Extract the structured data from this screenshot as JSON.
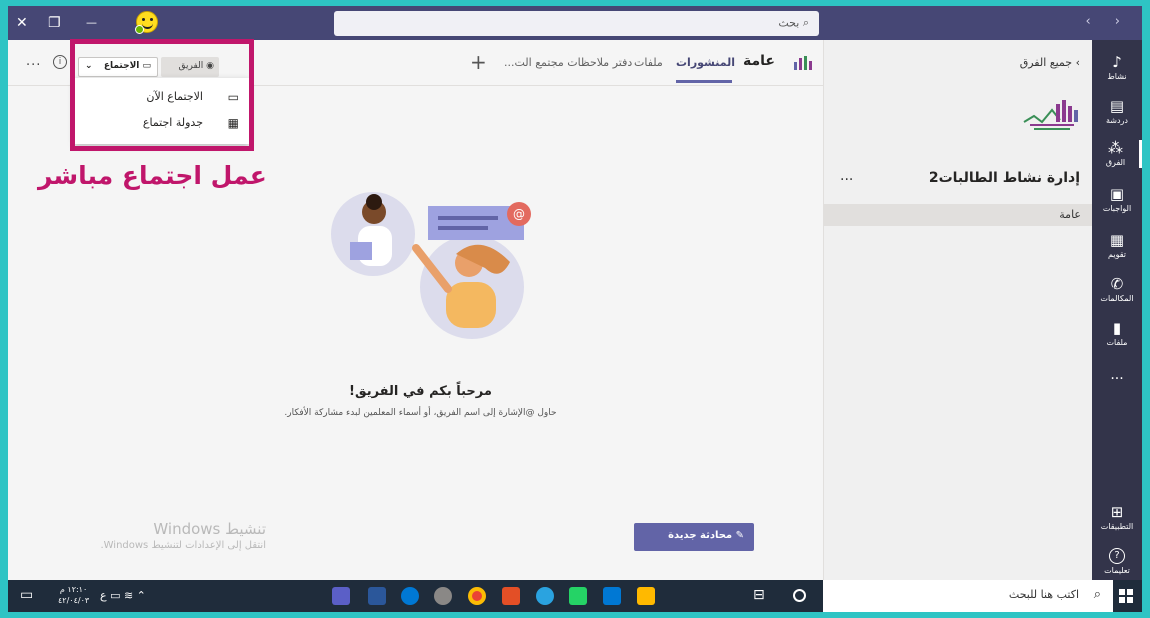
{
  "titlebar": {
    "search_placeholder": "بحث",
    "close_glyph": "✕",
    "restore_glyph": "❐",
    "minimize_glyph": "—",
    "nav_arrows": "‹ ›"
  },
  "rail": {
    "items": [
      {
        "label": "نشاط",
        "icon": "bell-icon",
        "glyph": "🔔︎"
      },
      {
        "label": "دردشة",
        "icon": "chat-icon",
        "glyph": "▤"
      },
      {
        "label": "الفرق",
        "icon": "teams-icon",
        "glyph": "⁂"
      },
      {
        "label": "الواجبات",
        "icon": "assignments-icon",
        "glyph": "▣"
      },
      {
        "label": "تقويم",
        "icon": "calendar-icon",
        "glyph": "▦"
      },
      {
        "label": "المكالمات",
        "icon": "phone-icon",
        "glyph": "✆"
      },
      {
        "label": "ملفات",
        "icon": "files-icon",
        "glyph": "▮"
      },
      {
        "label": "...",
        "icon": "more-icon",
        "glyph": ""
      },
      {
        "label": "التطبيقات",
        "icon": "apps-icon",
        "glyph": "⊞"
      },
      {
        "label": "تعليمات",
        "icon": "help-icon",
        "glyph": "?"
      }
    ]
  },
  "teampanel": {
    "all_teams": "جميع الفرق",
    "team_name": "إدارة نشاط الطالبات2",
    "more": "...",
    "channel": "عامة"
  },
  "header": {
    "channel_name": "عامة",
    "tabs": [
      "المنشورات",
      "ملفات",
      "دفتر ملاحظات مجتمع الت..."
    ],
    "meeting_button": "الاجتماع",
    "team_button": "الفريق",
    "more": "..."
  },
  "dropdown": {
    "meet_now": "الاجتماع الآن",
    "schedule": "جدولة اجتماع"
  },
  "annotation": "عمل اجتماع مباشر",
  "welcome": {
    "title": "مرحباً بكم في الفريق!",
    "subtitle": "حاول @الإشارة إلى اسم الفريق، أو أسماء المعلمين لبدء مشاركة الأفكار."
  },
  "new_conversation": "محادثة جديدة",
  "activation": {
    "title": "تنشيط Windows",
    "subtitle": "انتقل إلى الإعدادات لتنشيط Windows."
  },
  "taskbar": {
    "search_placeholder": "اكتب هنا للبحث",
    "time": "١٢:١٠ م",
    "date": "٤٢/٠٤/٠٣",
    "lang": "ع"
  },
  "colors": {
    "accent": "#6264a7",
    "titlebar": "#464775",
    "rail": "#33344a",
    "annotation": "#c0166b",
    "border": "#2ec4c4"
  }
}
